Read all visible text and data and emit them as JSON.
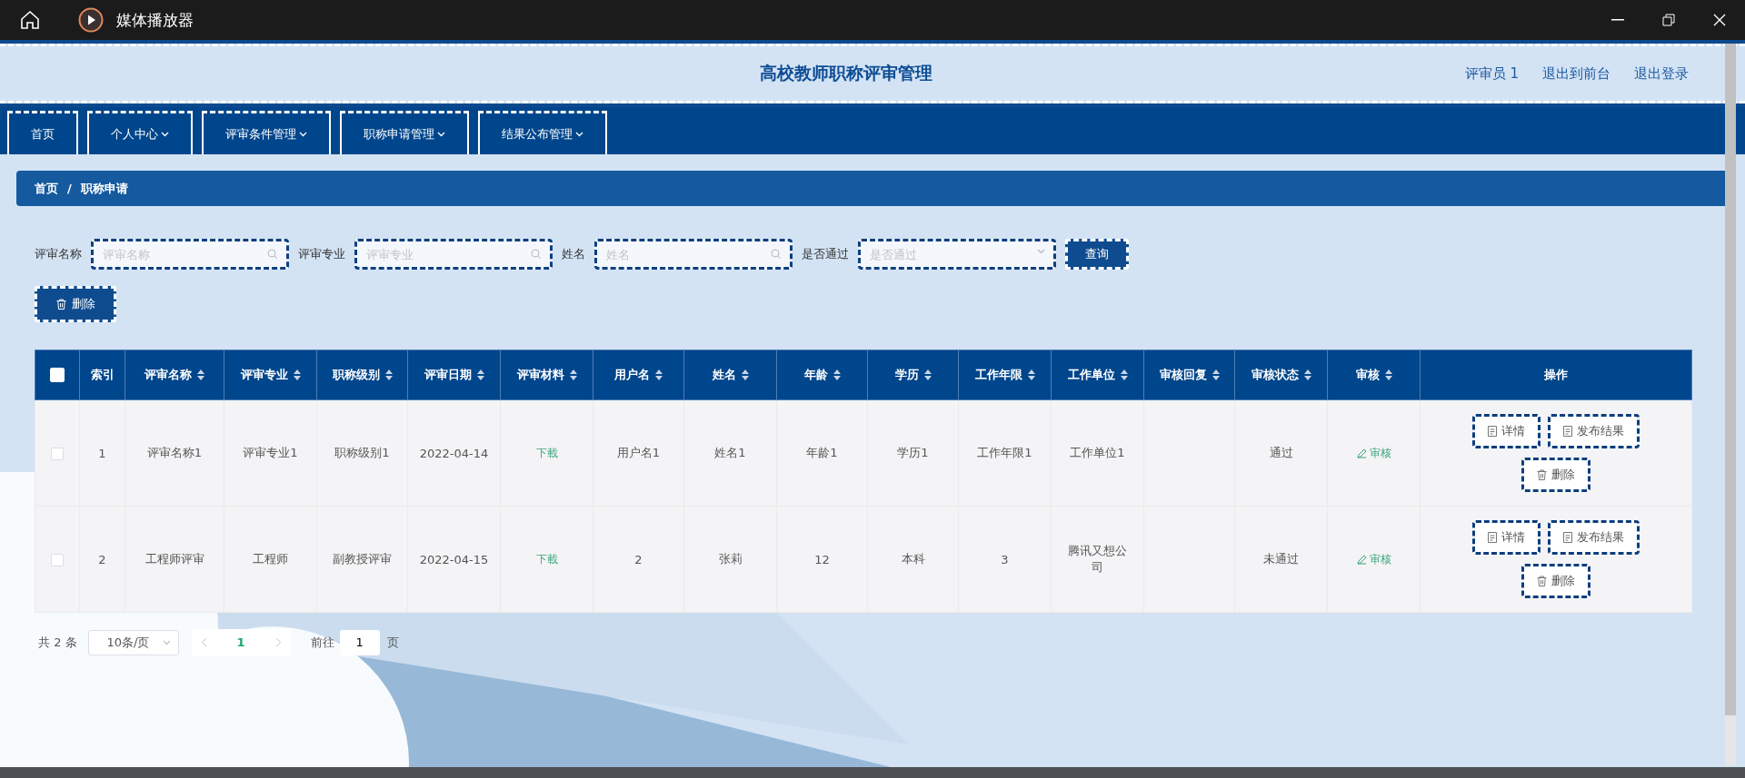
{
  "window": {
    "title": "媒体播放器"
  },
  "header": {
    "title": "高校教师职称评审管理",
    "links": [
      "评审员 1",
      "退出到前台",
      "退出登录"
    ]
  },
  "nav": [
    {
      "label": "首页",
      "dropdown": false,
      "selected": false
    },
    {
      "label": "个人中心",
      "dropdown": true,
      "selected": false
    },
    {
      "label": "评审条件管理",
      "dropdown": true,
      "selected": false
    },
    {
      "label": "职称申请管理",
      "dropdown": true,
      "selected": false
    },
    {
      "label": "结果公布管理",
      "dropdown": true,
      "selected": false
    }
  ],
  "breadcrumb": [
    "首页",
    "/",
    "职称申请"
  ],
  "filters": [
    {
      "label": "评审名称",
      "placeholder": "评审名称",
      "kind": "search"
    },
    {
      "label": "评审专业",
      "placeholder": "评审专业",
      "kind": "search"
    },
    {
      "label": "姓名",
      "placeholder": "姓名",
      "kind": "search"
    },
    {
      "label": "是否通过",
      "placeholder": "是否通过",
      "kind": "select"
    }
  ],
  "query_button": "查询",
  "delete_button": "删除",
  "table": {
    "select_all_checked": false,
    "columns": [
      {
        "label": "索引",
        "sortable": false
      },
      {
        "label": "评审名称",
        "sortable": true
      },
      {
        "label": "评审专业",
        "sortable": true
      },
      {
        "label": "职称级别",
        "sortable": true
      },
      {
        "label": "评审日期",
        "sortable": true
      },
      {
        "label": "评审材料",
        "sortable": true
      },
      {
        "label": "用户名",
        "sortable": true
      },
      {
        "label": "姓名",
        "sortable": true
      },
      {
        "label": "年龄",
        "sortable": true
      },
      {
        "label": "学历",
        "sortable": true
      },
      {
        "label": "工作年限",
        "sortable": true
      },
      {
        "label": "工作单位",
        "sortable": true
      },
      {
        "label": "审核回复",
        "sortable": true
      },
      {
        "label": "审核状态",
        "sortable": true
      },
      {
        "label": "审核",
        "sortable": true
      },
      {
        "label": "操作",
        "sortable": false
      }
    ],
    "rows": [
      {
        "checked": false,
        "cells": [
          {
            "kind": "text",
            "text": "1"
          },
          {
            "kind": "text",
            "text": "评审名称1"
          },
          {
            "kind": "text",
            "text": "评审专业1"
          },
          {
            "kind": "text",
            "text": "职称级别1"
          },
          {
            "kind": "text",
            "text": "2022-04-14"
          },
          {
            "kind": "link",
            "text": "下載"
          },
          {
            "kind": "text",
            "text": "用户名1"
          },
          {
            "kind": "text",
            "text": "姓名1"
          },
          {
            "kind": "text",
            "text": "年龄1"
          },
          {
            "kind": "text",
            "text": "学历1"
          },
          {
            "kind": "text",
            "text": "工作年限1"
          },
          {
            "kind": "text",
            "text": "工作单位1"
          },
          {
            "kind": "empty"
          },
          {
            "kind": "text",
            "text": "通过"
          },
          {
            "kind": "edit",
            "text": "审核"
          },
          {
            "kind": "actions",
            "buttons": [
              {
                "kind": "doc",
                "text": "详情"
              },
              {
                "kind": "doc",
                "text": "发布结果"
              },
              {
                "kind": "trash",
                "text": "删除"
              }
            ]
          }
        ]
      },
      {
        "checked": false,
        "cells": [
          {
            "kind": "text",
            "text": "2"
          },
          {
            "kind": "text",
            "text": "工程师评审"
          },
          {
            "kind": "text",
            "text": "工程师"
          },
          {
            "kind": "text",
            "text": "副教授评审"
          },
          {
            "kind": "text",
            "text": "2022-04-15"
          },
          {
            "kind": "link",
            "text": "下載"
          },
          {
            "kind": "text",
            "text": "2"
          },
          {
            "kind": "text",
            "text": "张莉"
          },
          {
            "kind": "text",
            "text": "12"
          },
          {
            "kind": "text",
            "text": "本科"
          },
          {
            "kind": "text",
            "text": "3"
          },
          {
            "kind": "text",
            "text": "腾讯又想公司"
          },
          {
            "kind": "empty"
          },
          {
            "kind": "text",
            "text": "未通过"
          },
          {
            "kind": "edit",
            "text": "审核"
          },
          {
            "kind": "actions",
            "buttons": [
              {
                "kind": "doc",
                "text": "详情"
              },
              {
                "kind": "doc",
                "text": "发布结果"
              },
              {
                "kind": "trash",
                "text": "删除"
              }
            ]
          }
        ]
      }
    ]
  },
  "pagination": {
    "total": "共 2 条",
    "page_size": "10条/页",
    "pages": [
      {
        "label": "1",
        "selected": true
      }
    ],
    "goto_label": "前往",
    "goto_value": "1",
    "page_unit": "页"
  }
}
